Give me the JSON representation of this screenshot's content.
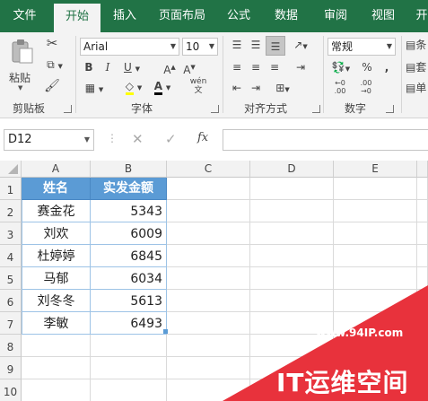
{
  "ribbon_tabs": [
    "文件",
    "开始",
    "插入",
    "页面布局",
    "公式",
    "数据",
    "审阅",
    "视图",
    "开"
  ],
  "active_tab": "开始",
  "clipboard": {
    "paste_label": "粘贴",
    "group_label": "剪贴板"
  },
  "font": {
    "name": "Arial",
    "size": "10",
    "group_label": "字体"
  },
  "alignment": {
    "group_label": "对齐方式"
  },
  "number": {
    "format": "常规",
    "group_label": "数字",
    "percent_symbol": "%",
    "comma_symbol": ","
  },
  "right_cut": [
    "条",
    "套",
    "单"
  ],
  "formula_bar": {
    "name_box": "D12",
    "fx_label": "fx",
    "content": ""
  },
  "columns": [
    "A",
    "B",
    "C",
    "D",
    "E"
  ],
  "rows": [
    "1",
    "2",
    "3",
    "4",
    "5",
    "6",
    "7",
    "8",
    "9",
    "10"
  ],
  "table": {
    "headers": [
      "姓名",
      "实发金额"
    ],
    "rows": [
      [
        "赛金花",
        "5343"
      ],
      [
        "刘欢",
        "6009"
      ],
      [
        "杜婷婷",
        "6845"
      ],
      [
        "马郁",
        "6034"
      ],
      [
        "刘冬冬",
        "5613"
      ],
      [
        "李敏",
        "6493"
      ]
    ]
  },
  "watermark": {
    "url": "www.94IP.com",
    "name": "IT运维空间",
    "color": "#e8323c"
  },
  "colors": {
    "ribbon_green": "#217346",
    "header_fill": "#5b9bd5"
  }
}
